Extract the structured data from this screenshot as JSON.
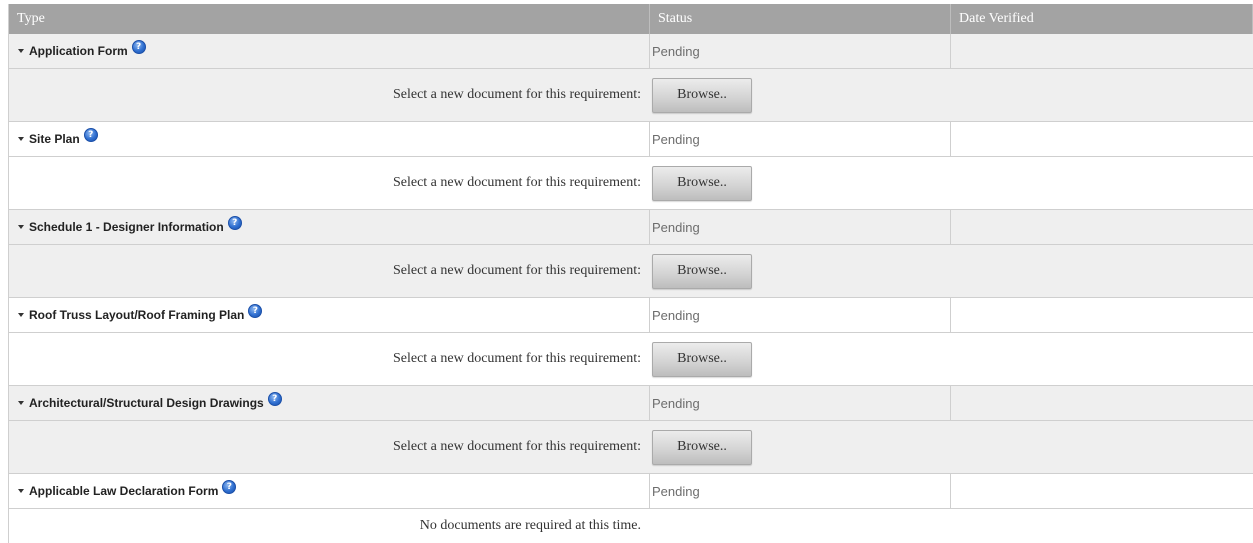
{
  "table": {
    "headers": {
      "type": "Type",
      "status": "Status",
      "date_verified": "Date Verified"
    },
    "help_glyph": "?",
    "upload_prompt": "Select a new document for this requirement:",
    "browse_label": "Browse..",
    "empty_message": "No documents are required at this time.",
    "requirements": [
      {
        "name": "Application Form",
        "status": "Pending",
        "date_verified": ""
      },
      {
        "name": "Site Plan",
        "status": "Pending",
        "date_verified": ""
      },
      {
        "name": "Schedule 1 - Designer Information",
        "status": "Pending",
        "date_verified": ""
      },
      {
        "name": "Roof Truss Layout/Roof Framing Plan",
        "status": "Pending",
        "date_verified": ""
      },
      {
        "name": "Architectural/Structural Design Drawings",
        "status": "Pending",
        "date_verified": ""
      },
      {
        "name": "Applicable Law Declaration Form",
        "status": "Pending",
        "date_verified": ""
      }
    ]
  },
  "icons": {
    "expand": "caret-down-icon",
    "help": "help-icon"
  },
  "colors": {
    "header_bg": "#a3a3a3",
    "row_shaded": "#efefef",
    "help_icon": "#2f6fd0"
  }
}
